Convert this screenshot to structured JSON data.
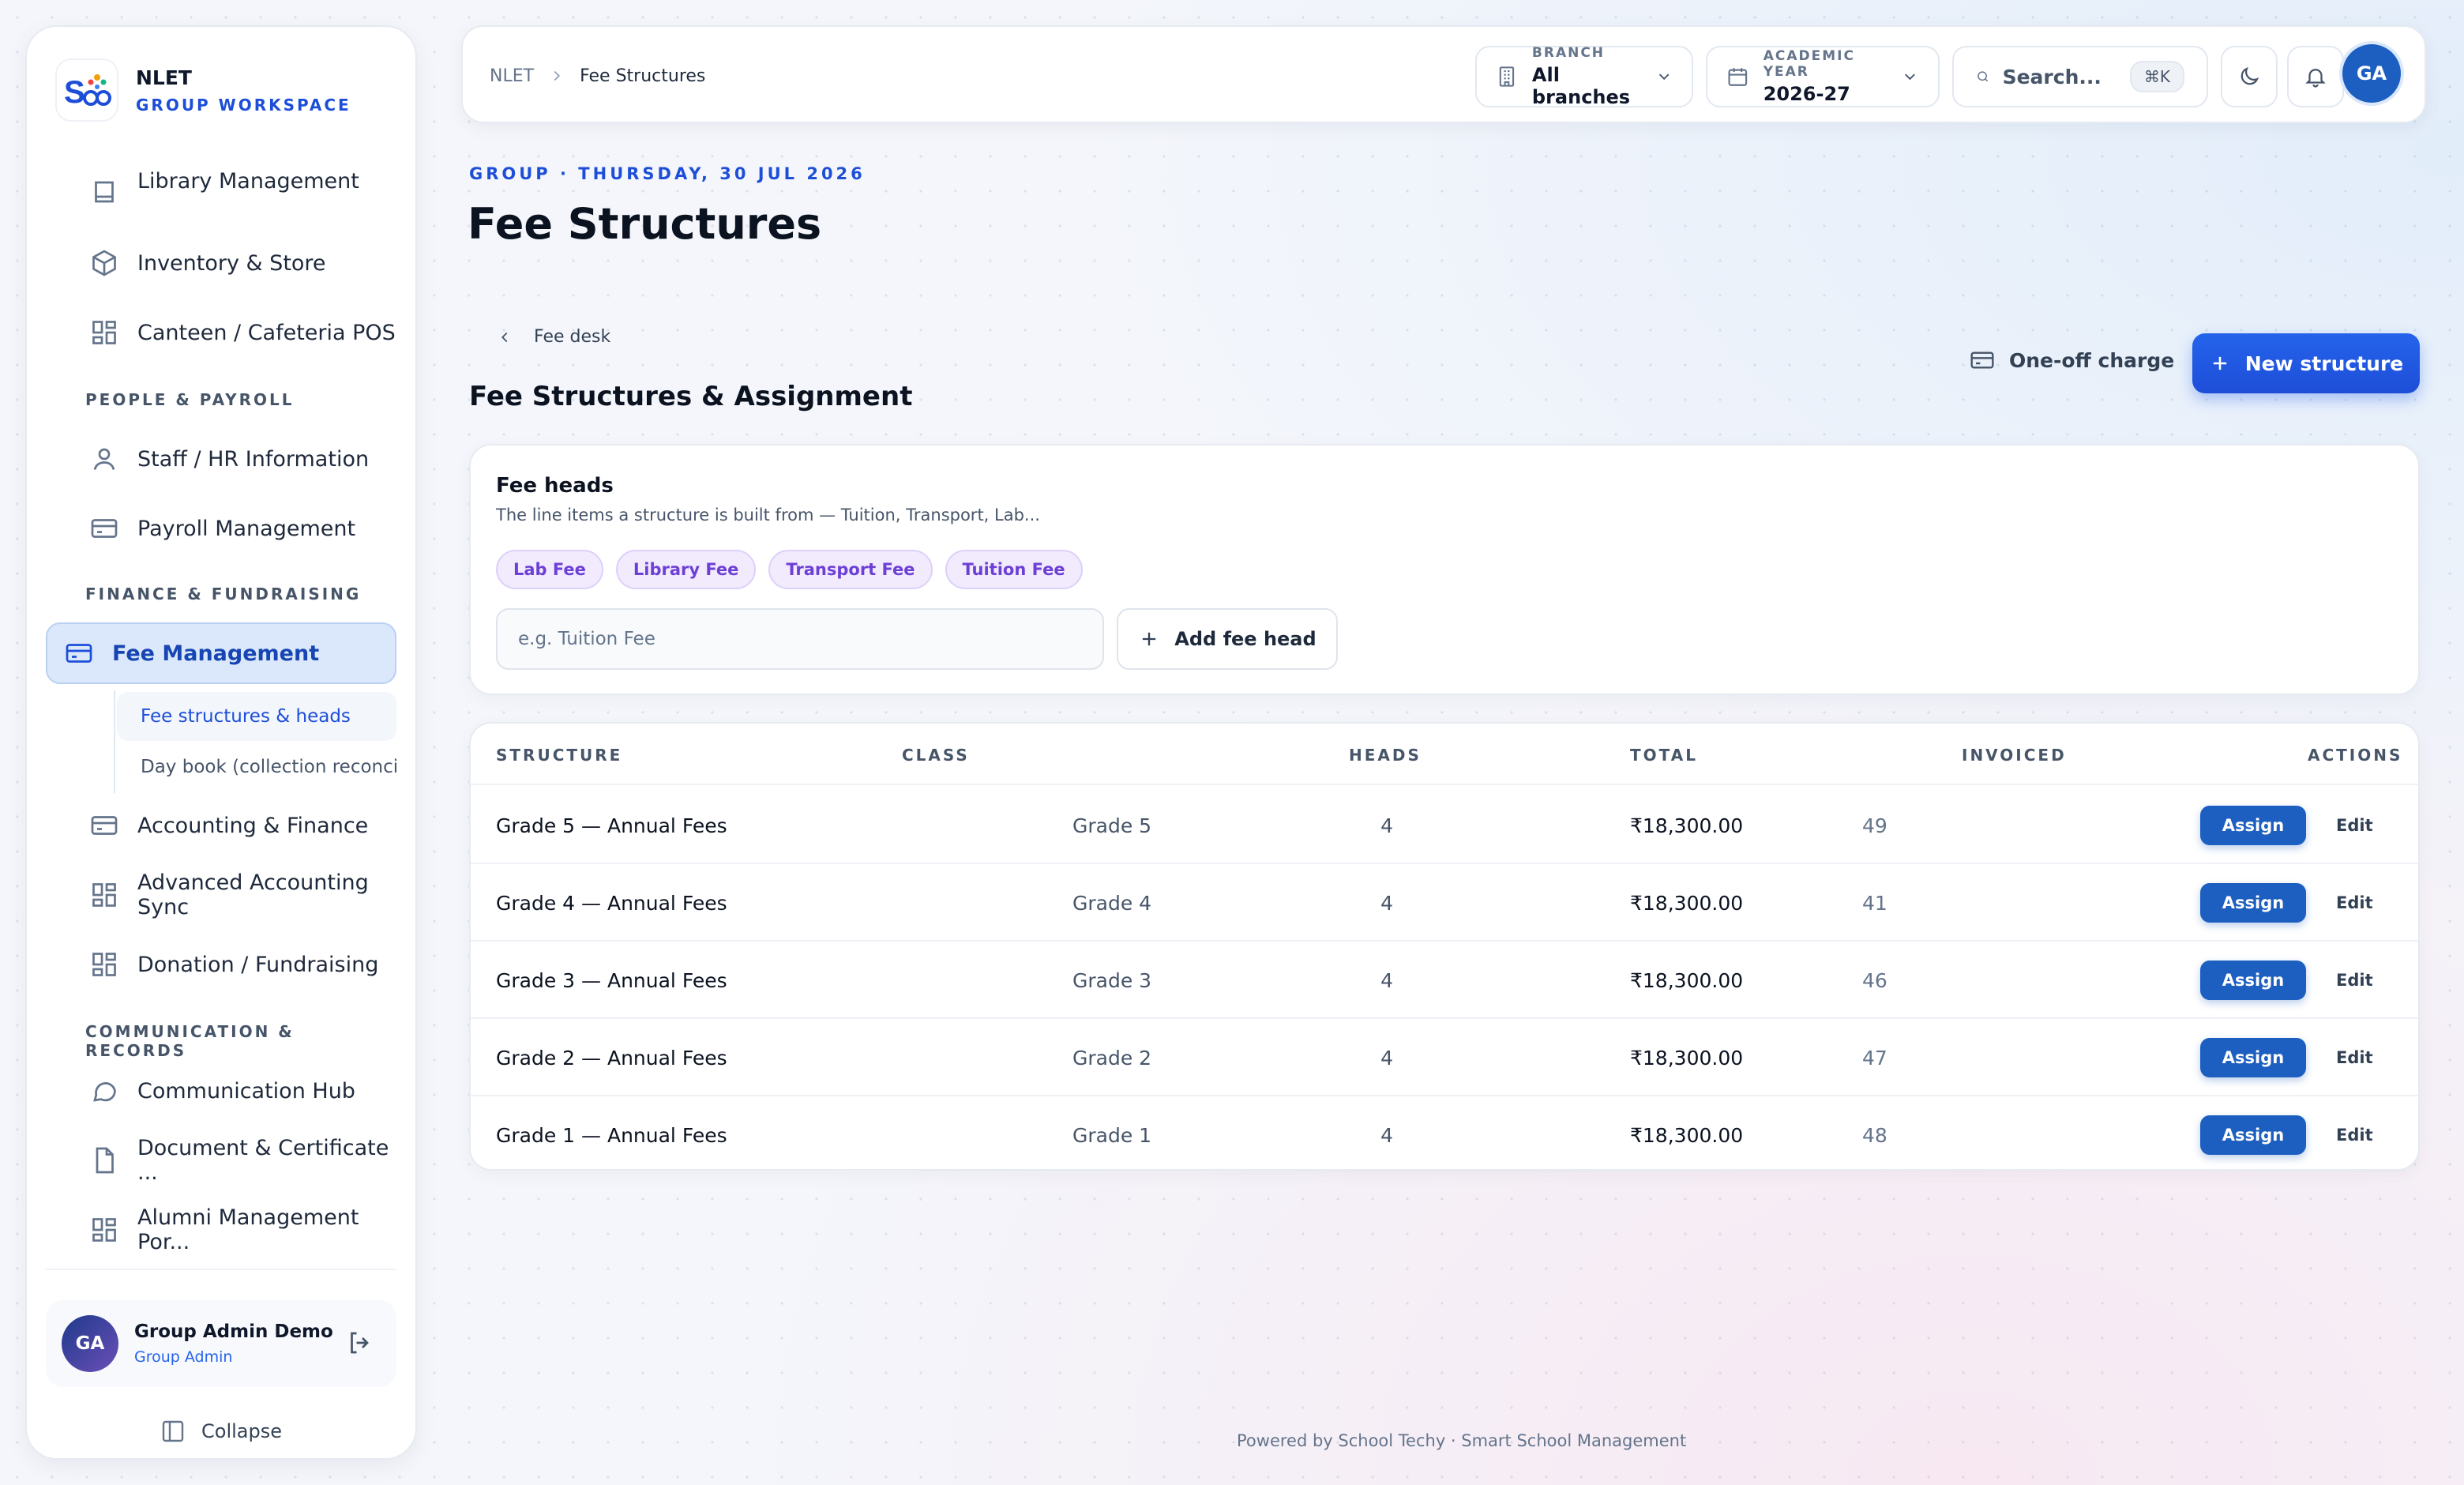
{
  "brand": {
    "name": "NLET",
    "subtitle": "GROUP WORKSPACE"
  },
  "sidebar": {
    "items_top": [
      {
        "label": "Library Management",
        "icon": "book-icon"
      },
      {
        "label": "Inventory & Store",
        "icon": "package-icon"
      },
      {
        "label": "Canteen / Cafeteria POS",
        "icon": "grid-icon"
      }
    ],
    "section_people": "PEOPLE & PAYROLL",
    "items_people": [
      {
        "label": "Staff / HR Information",
        "icon": "user-icon"
      },
      {
        "label": "Payroll Management",
        "icon": "card-icon"
      }
    ],
    "section_finance": "FINANCE & FUNDRAISING",
    "active_item": {
      "label": "Fee Management",
      "icon": "card-icon"
    },
    "sub_items": [
      {
        "label": "Fee structures & heads",
        "active": true
      },
      {
        "label": "Day book (collection reconcili..."
      }
    ],
    "items_finance": [
      {
        "label": "Accounting & Finance",
        "icon": "card-icon"
      },
      {
        "label": "Advanced Accounting Sync",
        "icon": "grid-icon"
      },
      {
        "label": "Donation / Fundraising",
        "icon": "grid-icon"
      }
    ],
    "section_comm": "COMMUNICATION & RECORDS",
    "items_comm": [
      {
        "label": "Communication Hub",
        "icon": "chat-icon"
      },
      {
        "label": "Document & Certificate ...",
        "icon": "file-icon"
      },
      {
        "label": "Alumni Management Por...",
        "icon": "grid-icon"
      }
    ],
    "profile": {
      "initials": "GA",
      "name": "Group Admin Demo",
      "role": "Group Admin"
    },
    "collapse_label": "Collapse"
  },
  "topbar": {
    "breadcrumb_root": "NLET",
    "breadcrumb_current": "Fee Structures",
    "branch_label": "BRANCH",
    "branch_value": "All branches",
    "year_label": "ACADEMIC YEAR",
    "year_value": "2026-27",
    "search_placeholder": "Search...",
    "search_shortcut": "⌘K",
    "avatar_initials": "GA"
  },
  "page": {
    "eyebrow": "GROUP · THURSDAY, 30 JUL 2026",
    "title": "Fee Structures",
    "back_label": "Fee desk",
    "section_title": "Fee Structures & Assignment",
    "oneoff_label": "One-off charge",
    "new_structure_label": "New structure"
  },
  "fee_heads": {
    "title": "Fee heads",
    "description": "The line items a structure is built from — Tuition, Transport, Lab...",
    "chips": [
      "Lab Fee",
      "Library Fee",
      "Transport Fee",
      "Tuition Fee"
    ],
    "input_placeholder": "e.g. Tuition Fee",
    "add_label": "Add fee head"
  },
  "table": {
    "headers": {
      "structure": "STRUCTURE",
      "class": "CLASS",
      "heads": "HEADS",
      "total": "TOTAL",
      "invoiced": "INVOICED",
      "actions": "ACTIONS"
    },
    "assign_label": "Assign",
    "edit_label": "Edit",
    "rows": [
      {
        "structure": "Grade 5 — Annual Fees",
        "class": "Grade 5",
        "heads": "4",
        "total": "₹18,300.00",
        "invoiced": "49"
      },
      {
        "structure": "Grade 4 — Annual Fees",
        "class": "Grade 4",
        "heads": "4",
        "total": "₹18,300.00",
        "invoiced": "41"
      },
      {
        "structure": "Grade 3 — Annual Fees",
        "class": "Grade 3",
        "heads": "4",
        "total": "₹18,300.00",
        "invoiced": "46"
      },
      {
        "structure": "Grade 2 — Annual Fees",
        "class": "Grade 2",
        "heads": "4",
        "total": "₹18,300.00",
        "invoiced": "47"
      },
      {
        "structure": "Grade 1 — Annual Fees",
        "class": "Grade 1",
        "heads": "4",
        "total": "₹18,300.00",
        "invoiced": "48"
      }
    ]
  },
  "footer": "Powered by School Techy · Smart School Management",
  "colors": {
    "accent": "#1d4ed8",
    "assign": "#1d5fc0",
    "chip_bg": "#f1ebfd",
    "chip_text": "#6d3fd6"
  }
}
